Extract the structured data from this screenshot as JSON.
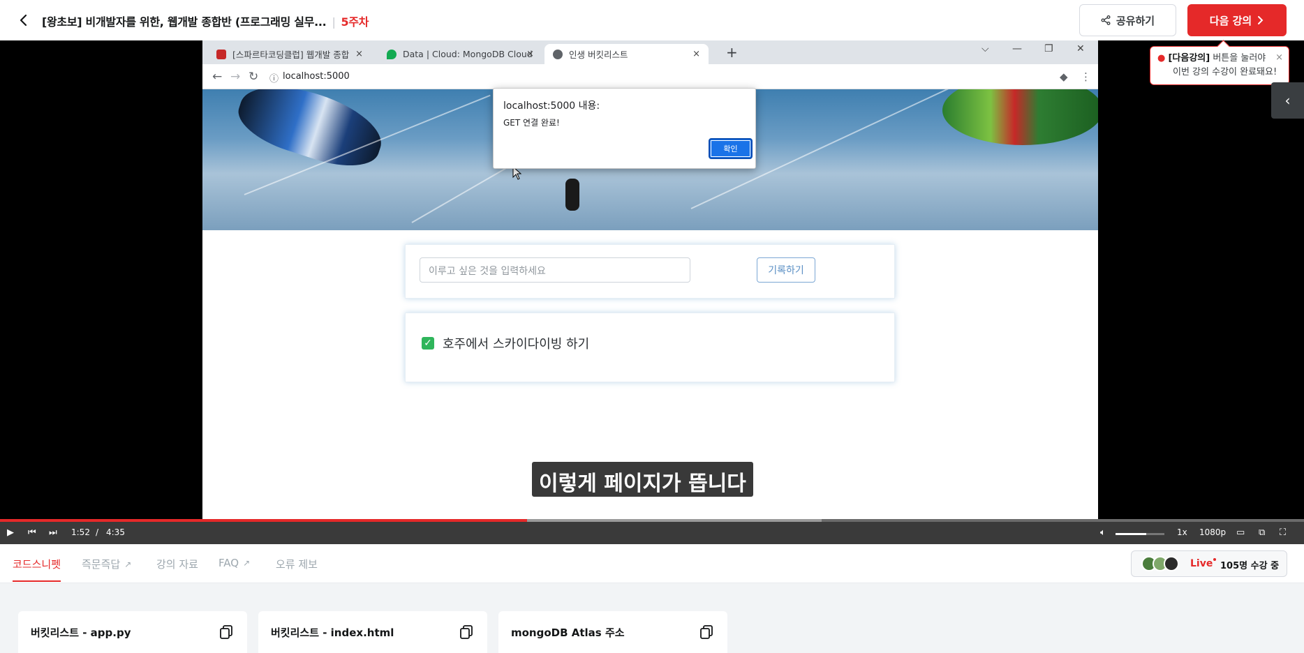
{
  "header": {
    "course_title": "[왕초보] 비개발자를 위한, 웹개발 종합반 (프로그래밍 실무...",
    "separator": "|",
    "week": "5주차",
    "share_label": "공유하기",
    "next_label": "다음 강의"
  },
  "toast": {
    "bold": "[다음강의]",
    "line1": " 버튼을 눌러야",
    "line2": "이번 강의 수강이 완료돼요!",
    "close": "×"
  },
  "browser": {
    "tabs": [
      {
        "label": "[스파르타코딩클럽] 웹개발 종합",
        "close": "×"
      },
      {
        "label": "Data | Cloud: MongoDB Cloud",
        "close": "×"
      },
      {
        "label": "인생 버킷리스트",
        "close": "×"
      }
    ],
    "new_tab": "+",
    "url": "localhost:5000"
  },
  "alert": {
    "title": "localhost:5000 내용:",
    "message": "GET 연결 완료!",
    "ok_label": "확인"
  },
  "app": {
    "input_placeholder": "이루고 싶은 것을 입력하세요",
    "record_label": "기록하기",
    "items": [
      {
        "text": "호주에서 스카이다이빙 하기",
        "done": true
      }
    ]
  },
  "video": {
    "subtitle": "이렇게 페이지가 뜹니다",
    "current_time": "1:52",
    "time_sep": "/",
    "duration": "4:35",
    "played_fraction": 0.4043,
    "buffered_fraction": 0.63,
    "speed": "1x",
    "quality": "1080p"
  },
  "bottom": {
    "tabs": [
      {
        "label": "코드스니펫",
        "active": true
      },
      {
        "label": "즉문즉답",
        "external": true
      },
      {
        "label": "강의 자료"
      },
      {
        "label": "FAQ",
        "external": true
      },
      {
        "label": "오류 제보"
      }
    ],
    "live_label": "Live",
    "live_count": "105명 수강 중",
    "snippets": [
      {
        "title": "버킷리스트 - app.py"
      },
      {
        "title": "버킷리스트 - index.html"
      },
      {
        "title": "mongoDB Atlas 주소"
      }
    ]
  },
  "colors": {
    "accent": "#e52929",
    "check": "#2fb55b",
    "dialog_button": "#1a73e8"
  }
}
